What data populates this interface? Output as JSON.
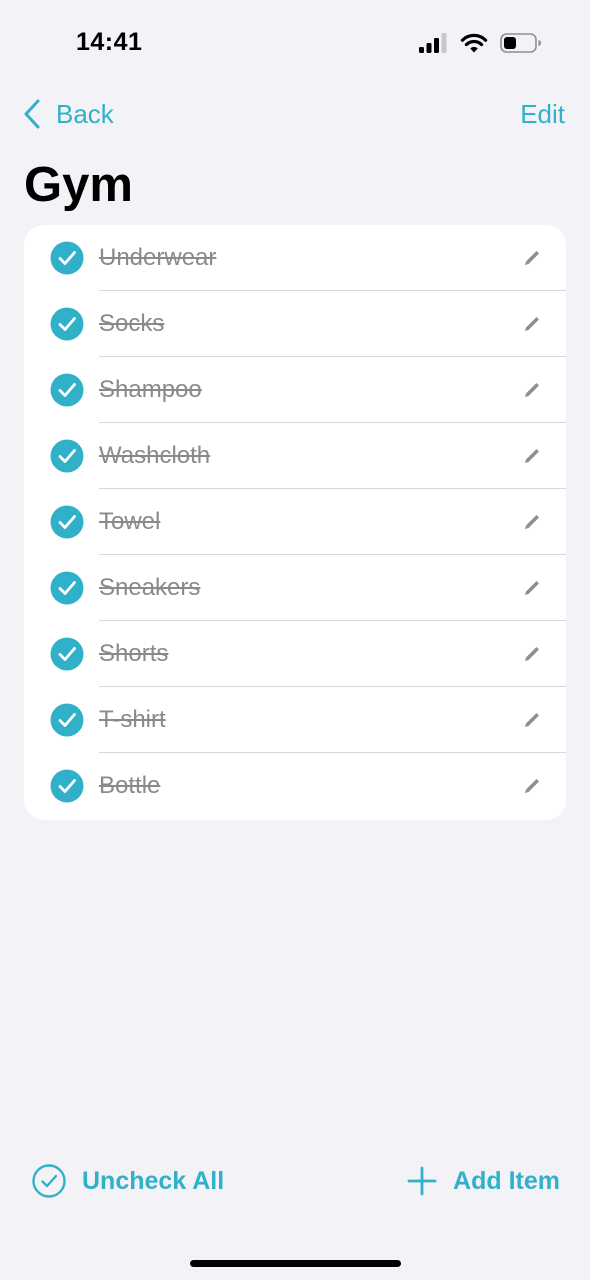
{
  "status_bar": {
    "time": "14:41",
    "icons": [
      "signal-icon",
      "wifi-icon",
      "battery-icon"
    ]
  },
  "nav": {
    "back_label": "Back",
    "edit_label": "Edit"
  },
  "title": "Gym",
  "items": [
    {
      "label": "Underwear",
      "checked": true
    },
    {
      "label": "Socks",
      "checked": true
    },
    {
      "label": "Shampoo",
      "checked": true
    },
    {
      "label": "Washcloth",
      "checked": true
    },
    {
      "label": "Towel",
      "checked": true
    },
    {
      "label": "Sneakers",
      "checked": true
    },
    {
      "label": "Shorts",
      "checked": true
    },
    {
      "label": "T-shirt",
      "checked": true
    },
    {
      "label": "Bottle",
      "checked": true
    }
  ],
  "toolbar": {
    "uncheck_all_label": "Uncheck All",
    "add_item_label": "Add Item"
  },
  "colors": {
    "accent": "#31b1c9",
    "background": "#f2f2f7",
    "card": "#ffffff",
    "checked_text": "#8a8a8e"
  }
}
